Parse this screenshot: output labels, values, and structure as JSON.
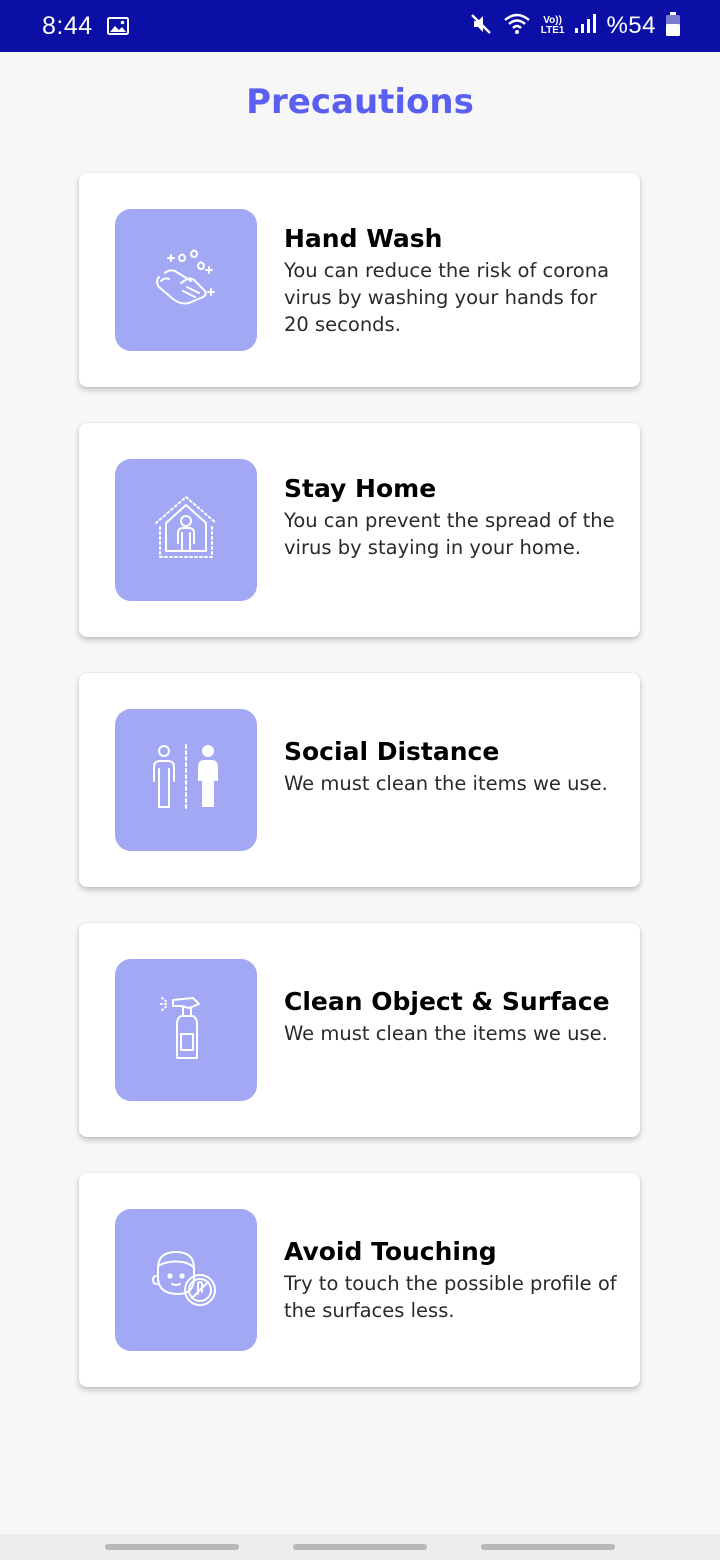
{
  "status_bar": {
    "time": "8:44",
    "battery_text": "%54",
    "icons": [
      "gallery-icon",
      "mute-icon",
      "wifi-icon",
      "volte-icon",
      "signal-icon",
      "battery-icon"
    ],
    "network_label_top": "Vo))",
    "network_label_bottom": "LTE1"
  },
  "page": {
    "title": "Precautions"
  },
  "cards": [
    {
      "icon": "hand-wash-icon",
      "title": "Hand Wash",
      "description": "You can reduce the risk of corona virus by washing your hands for 20 seconds."
    },
    {
      "icon": "stay-home-icon",
      "title": "Stay Home",
      "description": "You can prevent the spread of the virus by staying in your home."
    },
    {
      "icon": "social-distance-icon",
      "title": "Social Distance",
      "description": "We must clean the items we use."
    },
    {
      "icon": "spray-bottle-icon",
      "title": "Clean Object & Surface",
      "description": "We must clean the items we use."
    },
    {
      "icon": "avoid-touching-icon",
      "title": "Avoid Touching",
      "description": "Try to touch the possible profile of the surfaces less."
    }
  ],
  "colors": {
    "status_bar": "#0b0fa6",
    "title": "#5a5ff0",
    "icon_box": "#a2a8f3",
    "background": "#f7f7f7"
  }
}
